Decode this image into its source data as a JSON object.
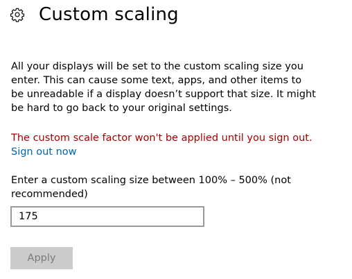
{
  "header": {
    "icon": "gear-icon",
    "title": "Custom scaling"
  },
  "description": "All your displays will be set to the custom scaling size you enter. This can cause some text, apps, and other items to be unreadable if a display doesn’t support that size. It might be hard to go back to your original settings.",
  "warning": {
    "text": "The custom scale factor won't be applied until you sign out.",
    "color": "#a80000"
  },
  "sign_out_link": {
    "label": "Sign out now",
    "color": "#0063b1"
  },
  "scaling_input": {
    "prompt": "Enter a custom scaling size between 100% – 500% (not recommended)",
    "value": "175"
  },
  "apply_button": {
    "label": "Apply",
    "state": "disabled"
  }
}
